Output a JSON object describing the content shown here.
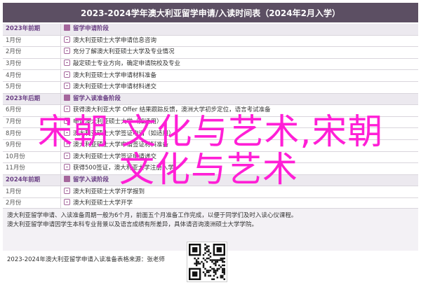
{
  "header": {
    "title": "2023-2024学年澳大利亚留学申请/入读时间表（2024年2月入学）"
  },
  "timeline": [
    {
      "kind": "section",
      "month": "2023年前期",
      "text": "留学申请阶段"
    },
    {
      "kind": "row",
      "month": "1月份",
      "text": "澳大利亚硕士大学申请信息咨询"
    },
    {
      "kind": "row",
      "month": "2月份",
      "text": "充分了解澳大利亚硕士大学及专业情况"
    },
    {
      "kind": "row",
      "month": "3月份",
      "text": "敲定硕士专业方向，确定申请院校及专业"
    },
    {
      "kind": "row",
      "month": "4月份",
      "text": "澳大利亚硕士大学申请材料准备"
    },
    {
      "kind": "row",
      "month": "5月份",
      "text": "澳大利亚硕士大学申请材料递交"
    },
    {
      "kind": "section",
      "month": "2023年后期",
      "text": "留学入读准备阶段"
    },
    {
      "kind": "row",
      "month": "6月份",
      "text": "获得澳大利亚大学 Offer 结果跟踪反馈，澳洲大学初步定位，语言考试准备"
    },
    {
      "kind": "row",
      "month": "7月份",
      "text": "申请澳大利亚硕士大学（如适用）"
    },
    {
      "kind": "row",
      "month": "8月份",
      "text": "澳大利亚硕士大学签证申请（如适用）"
    },
    {
      "kind": "row",
      "month": "9月份",
      "text": "澳大利亚硕士大学申请签证材料准备"
    },
    {
      "kind": "row",
      "month": "10月份",
      "text": "澳大利亚硕士大学签证申请递交"
    },
    {
      "kind": "row",
      "month": "11月份",
      "text": "获得500签证，澳大利亚大学注册入学"
    },
    {
      "kind": "section",
      "month": "2024年前期",
      "text": "留学入读阶段"
    },
    {
      "kind": "row",
      "month": "1月份",
      "text": "澳大利亚硕士大学开学报到"
    },
    {
      "kind": "row",
      "month": "2月份",
      "text": "澳大利亚硕士大学开学"
    }
  ],
  "notes": [
    "澳大利亚留学申请、入读准备周期一般为6个月，前面五个月准备工作完成，以便于同学们及时入读心仪课程。",
    "澳大利亚留学申请因学生本科专业背景以及语言成绩有所差异，具体请咨询澳洲硕士大学学院。"
  ],
  "footer": {
    "source": "2023-2024年澳大利亚留学申请入读准备表格来源：张老师"
  },
  "overlay": {
    "line1": "宋朝 文化与艺术,宋朝",
    "line2": "文化与艺术",
    "color": "#ff1fd6"
  }
}
